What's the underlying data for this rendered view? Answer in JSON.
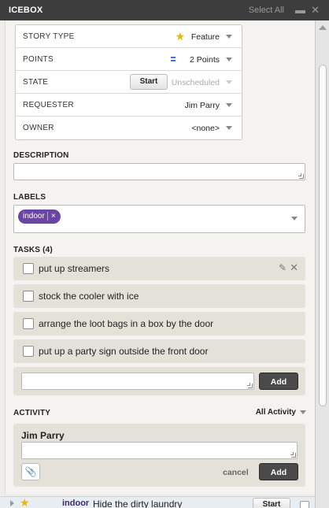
{
  "header": {
    "title": "ICEBOX",
    "select_all": "Select All"
  },
  "props": {
    "story_type": {
      "label": "STORY TYPE",
      "value": "Feature"
    },
    "points": {
      "label": "POINTS",
      "value": "2 Points"
    },
    "state": {
      "label": "STATE",
      "button": "Start",
      "value": "Unscheduled"
    },
    "requester": {
      "label": "REQUESTER",
      "value": "Jim Parry"
    },
    "owner": {
      "label": "OWNER",
      "value": "<none>"
    }
  },
  "description": {
    "label": "DESCRIPTION",
    "value": ""
  },
  "labels": {
    "label": "LABELS",
    "chips": [
      "indoor"
    ],
    "remove": "×"
  },
  "tasks": {
    "label": "TASKS (4)",
    "items": [
      {
        "text": "put up streamers",
        "checked": false
      },
      {
        "text": "stock the cooler with ice",
        "checked": false
      },
      {
        "text": "arrange the loot bags in a box by the door",
        "checked": false
      },
      {
        "text": "put up a party sign outside the front door",
        "checked": false
      }
    ],
    "add_label": "Add",
    "new_task_value": ""
  },
  "activity": {
    "label": "ACTIVITY",
    "filter": "All Activity",
    "author": "Jim Parry",
    "comment_value": "",
    "cancel_label": "cancel",
    "add_label": "Add"
  },
  "next_story": {
    "label": "indoor",
    "title": "Hide the dirty laundry",
    "button": "Start"
  },
  "icons": {
    "feature": "star-icon",
    "points": "points-icon",
    "edit": "pencil-icon",
    "delete": "close-icon",
    "attach": "paperclip-icon"
  },
  "colors": {
    "header_bg": "#3d3d3d",
    "chip_bg": "#6a45a3",
    "star": "#e8b800",
    "points": "#3b73d1"
  }
}
